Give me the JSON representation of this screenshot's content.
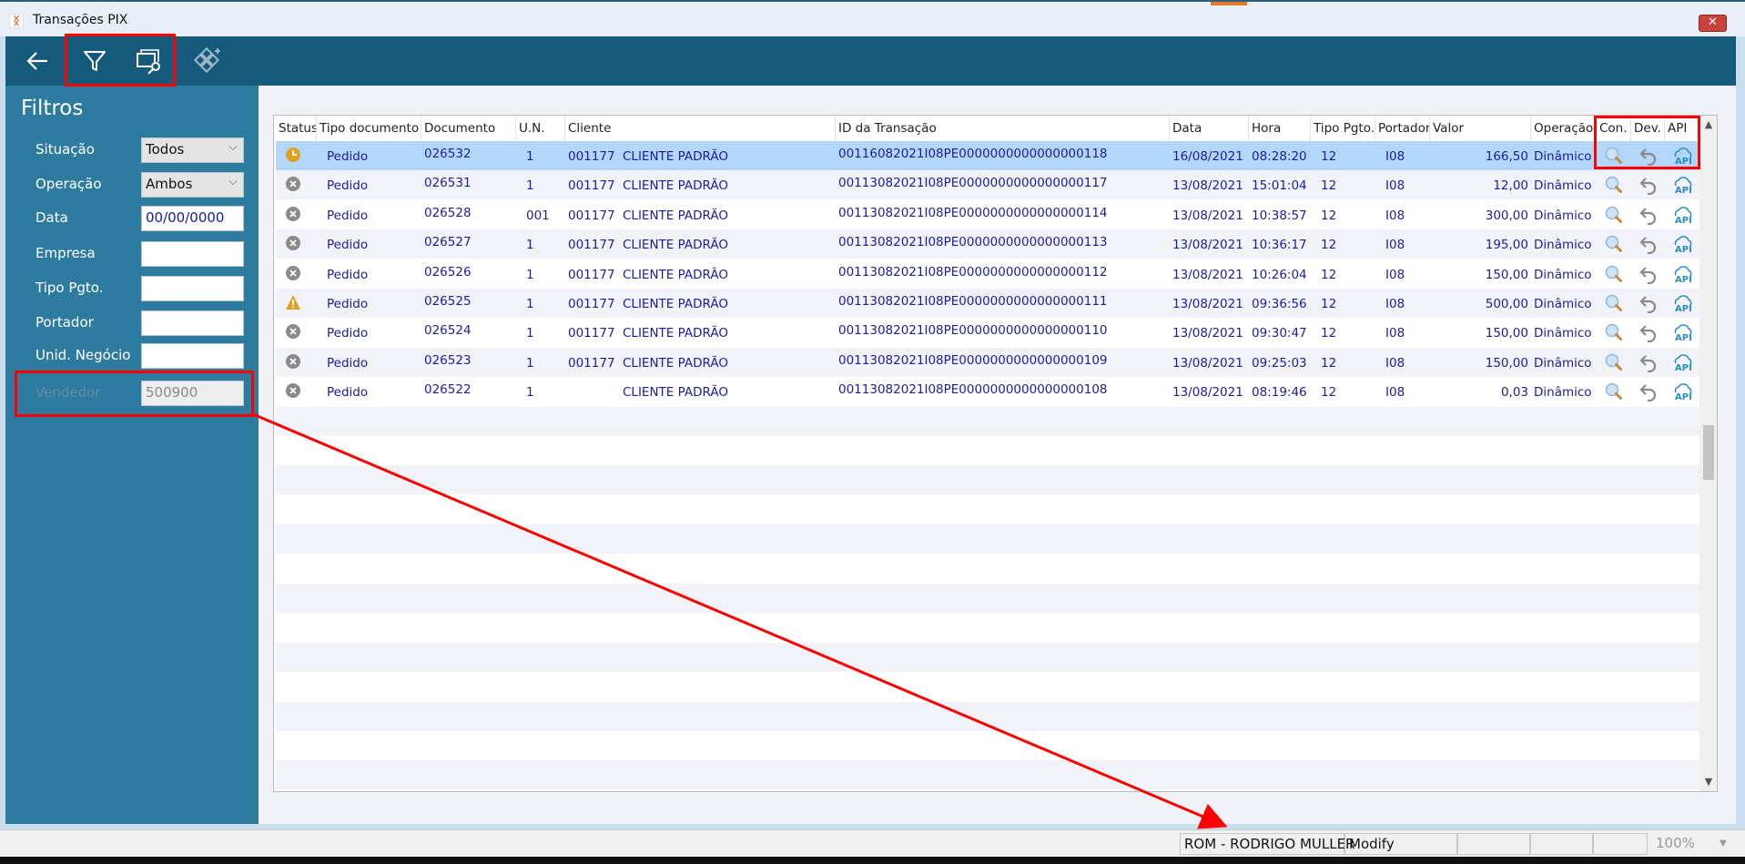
{
  "window": {
    "title": "Transações PIX",
    "close_label": "✕"
  },
  "toolbar": {
    "buttons": [
      {
        "name": "back-icon"
      },
      {
        "name": "filter-icon"
      },
      {
        "name": "search-windows-icon"
      },
      {
        "name": "add-module-icon"
      }
    ]
  },
  "filters": {
    "title": "Filtros",
    "fields": [
      {
        "label": "Situação",
        "value": "Todos",
        "type": "select"
      },
      {
        "label": "Operação",
        "value": "Ambos",
        "type": "select"
      },
      {
        "label": "Data",
        "value": "00/00/0000",
        "type": "input"
      },
      {
        "label": "Empresa",
        "value": "",
        "type": "input"
      },
      {
        "label": "Tipo Pgto.",
        "value": "",
        "type": "input"
      },
      {
        "label": "Portador",
        "value": "",
        "type": "input"
      },
      {
        "label": "Unid. Negócio",
        "value": "",
        "type": "input"
      },
      {
        "label": "Vendedor",
        "value": "500900",
        "type": "disabled"
      }
    ]
  },
  "table": {
    "columns": [
      "Status",
      "Tipo documento",
      "Documento",
      "U.N.",
      "Cliente",
      "ID da Transação",
      "Data",
      "Hora",
      "Tipo Pgto.",
      "Portador",
      "Valor",
      "Operação",
      "Con.",
      "Dev.",
      "API"
    ],
    "rows": [
      {
        "status": "pending",
        "tipo": "Pedido",
        "doc": "026532",
        "un": "1",
        "cli_cod": "001177",
        "cli": "CLIENTE PADRÃO",
        "id": "00116082021I08PE0000000000000000118",
        "data": "16/08/2021",
        "hora": "08:28:20",
        "tipo_pgto": "12",
        "portador": "I08",
        "valor": "166,50",
        "op": "Dinâmico",
        "selected": true
      },
      {
        "status": "cancelled",
        "tipo": "Pedido",
        "doc": "026531",
        "un": "1",
        "cli_cod": "001177",
        "cli": "CLIENTE PADRÃO",
        "id": "00113082021I08PE0000000000000000117",
        "data": "13/08/2021",
        "hora": "15:01:04",
        "tipo_pgto": "12",
        "portador": "I08",
        "valor": "12,00",
        "op": "Dinâmico"
      },
      {
        "status": "cancelled",
        "tipo": "Pedido",
        "doc": "026528",
        "un": "001",
        "cli_cod": "001177",
        "cli": "CLIENTE PADRÃO",
        "id": "00113082021I08PE0000000000000000114",
        "data": "13/08/2021",
        "hora": "10:38:57",
        "tipo_pgto": "12",
        "portador": "I08",
        "valor": "300,00",
        "op": "Dinâmico"
      },
      {
        "status": "cancelled",
        "tipo": "Pedido",
        "doc": "026527",
        "un": "1",
        "cli_cod": "001177",
        "cli": "CLIENTE PADRÃO",
        "id": "00113082021I08PE0000000000000000113",
        "data": "13/08/2021",
        "hora": "10:36:17",
        "tipo_pgto": "12",
        "portador": "I08",
        "valor": "195,00",
        "op": "Dinâmico"
      },
      {
        "status": "cancelled",
        "tipo": "Pedido",
        "doc": "026526",
        "un": "1",
        "cli_cod": "001177",
        "cli": "CLIENTE PADRÃO",
        "id": "00113082021I08PE0000000000000000112",
        "data": "13/08/2021",
        "hora": "10:26:04",
        "tipo_pgto": "12",
        "portador": "I08",
        "valor": "150,00",
        "op": "Dinâmico"
      },
      {
        "status": "warning",
        "tipo": "Pedido",
        "doc": "026525",
        "un": "1",
        "cli_cod": "001177",
        "cli": "CLIENTE PADRÃO",
        "id": "00113082021I08PE0000000000000000111",
        "data": "13/08/2021",
        "hora": "09:36:56",
        "tipo_pgto": "12",
        "portador": "I08",
        "valor": "500,00",
        "op": "Dinâmico"
      },
      {
        "status": "cancelled",
        "tipo": "Pedido",
        "doc": "026524",
        "un": "1",
        "cli_cod": "001177",
        "cli": "CLIENTE PADRÃO",
        "id": "00113082021I08PE0000000000000000110",
        "data": "13/08/2021",
        "hora": "09:30:47",
        "tipo_pgto": "12",
        "portador": "I08",
        "valor": "150,00",
        "op": "Dinâmico"
      },
      {
        "status": "cancelled",
        "tipo": "Pedido",
        "doc": "026523",
        "un": "1",
        "cli_cod": "001177",
        "cli": "CLIENTE PADRÃO",
        "id": "00113082021I08PE0000000000000000109",
        "data": "13/08/2021",
        "hora": "09:25:03",
        "tipo_pgto": "12",
        "portador": "I08",
        "valor": "150,00",
        "op": "Dinâmico"
      },
      {
        "status": "cancelled",
        "tipo": "Pedido",
        "doc": "026522",
        "un": "1",
        "cli_cod": "",
        "cli": "CLIENTE PADRÃO",
        "id": "00113082021I08PE0000000000000000108",
        "data": "13/08/2021",
        "hora": "08:19:46",
        "tipo_pgto": "12",
        "portador": "I08",
        "valor": "0,03",
        "op": "Dinâmico"
      }
    ]
  },
  "statusbar": {
    "user": "ROM - RODRIGO MULLER",
    "mode": "Modify",
    "zoom": "100%"
  },
  "colors": {
    "toolbar": "#155a7a",
    "panel": "#2e7ba0",
    "selected_row": "#b3d7fb",
    "text": "#1c1ca0",
    "annotation": "#ff0000"
  }
}
